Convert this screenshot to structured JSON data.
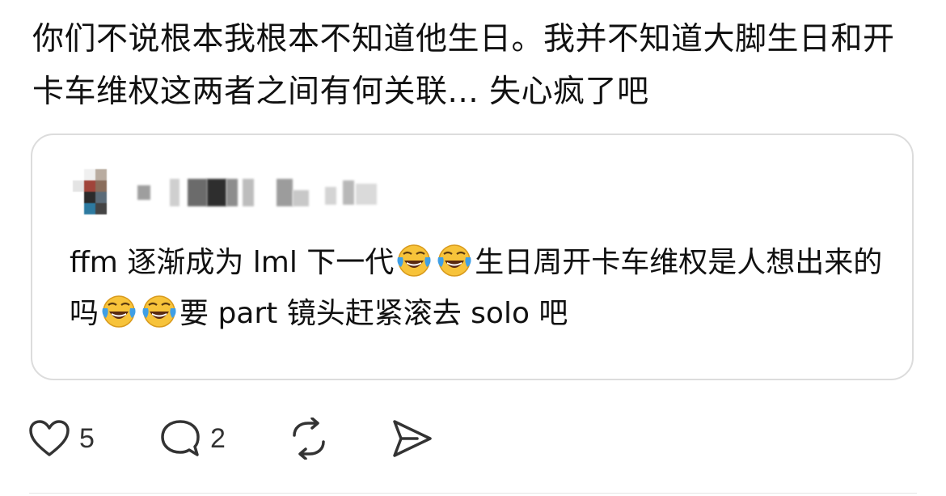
{
  "post": {
    "text": "你们不说根本我根本不知道他生日。我并不知道大脚生日和开卡车维权这两者之间有何关联... 失心疯了吧"
  },
  "quote": {
    "text_part1": "ffm 逐渐成为 lml 下一代",
    "text_part2": "生日周开卡车维权是人想出来的吗",
    "text_part3": "要 part 镜头赶紧滚去 solo 吧",
    "emoji_name": "face-with-tears-of-joy"
  },
  "actions": {
    "like_count": "5",
    "reply_count": "2"
  },
  "colors": {
    "text": "#111111",
    "card_border": "#dcdcdc",
    "icon": "#333333",
    "emoji_yellow": "#f7c33a",
    "emoji_tear": "#3f9fe6"
  }
}
